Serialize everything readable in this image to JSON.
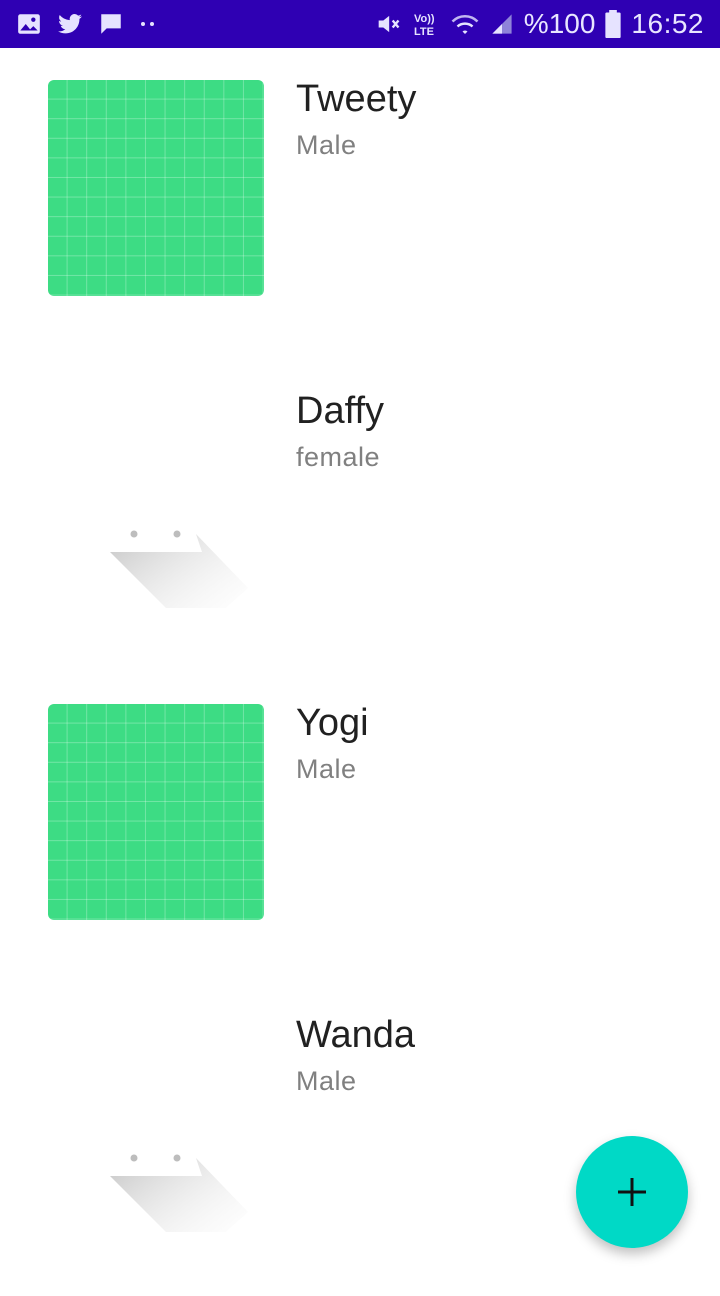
{
  "status_bar": {
    "battery_percent": "%100",
    "time": "16:52",
    "left_icons": [
      "image-icon",
      "twitter-icon",
      "chat-icon",
      "more-dots-icon"
    ],
    "right_icons": [
      "mute-icon",
      "volte-icon",
      "wifi-icon",
      "signal-icon",
      "battery-icon"
    ],
    "volte_label": "Vo)) LTE"
  },
  "items": [
    {
      "name": "Tweety",
      "gender": "Male",
      "thumbnail": "green-grid-image"
    },
    {
      "name": "Daffy",
      "gender": "female",
      "thumbnail": "placeholder-image"
    },
    {
      "name": "Yogi",
      "gender": "Male",
      "thumbnail": "green-grid-image"
    },
    {
      "name": "Wanda",
      "gender": "Male",
      "thumbnail": "placeholder-image"
    }
  ],
  "fab": {
    "icon": "plus-icon"
  },
  "colors": {
    "status_bar": "#2f00b3",
    "thumbnail_green": "#3ddc84",
    "fab": "#00d9c6",
    "name_text": "#212121",
    "gender_text": "#808080"
  }
}
